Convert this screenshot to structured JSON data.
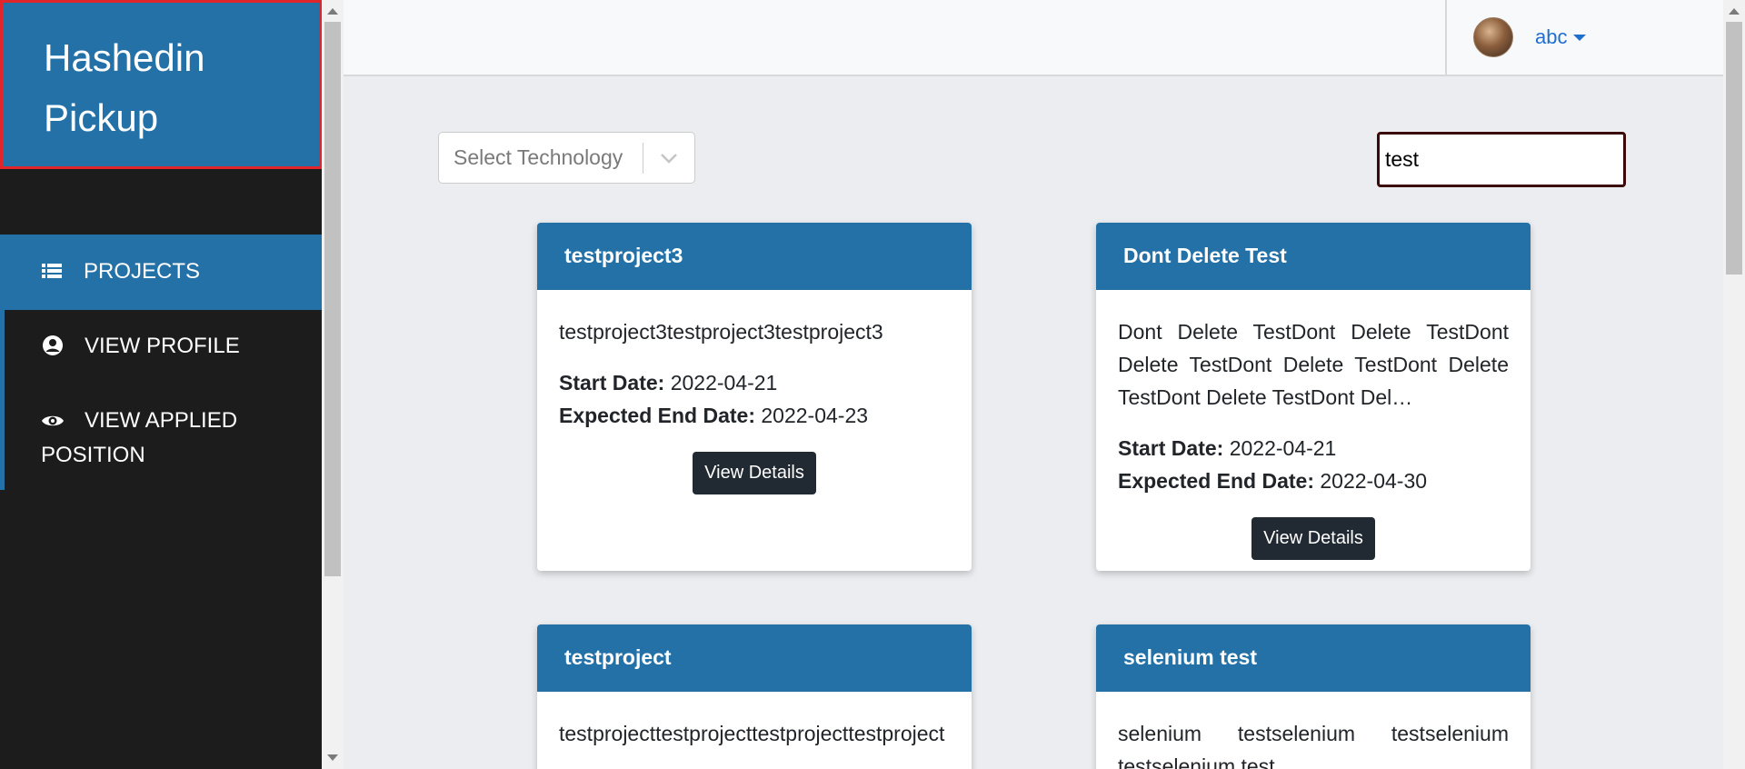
{
  "brand": {
    "line1": "Hashedin",
    "line2": "Pickup"
  },
  "nav": {
    "projects": "PROJECTS",
    "view_profile": "VIEW PROFILE",
    "view_applied_line1": "VIEW APPLIED",
    "view_applied_line2": "POSITION"
  },
  "header": {
    "user_name": "abc"
  },
  "filters": {
    "technology_placeholder": "Select Technology",
    "search_value": "test"
  },
  "labels": {
    "start_date": "Start Date:",
    "end_date": "Expected End Date:",
    "view_details": "View Details"
  },
  "projects": [
    {
      "title": "testproject3",
      "description": "testproject3testproject3testproject3",
      "start_date": "2022-04-21",
      "end_date": "2022-04-23"
    },
    {
      "title": "Dont Delete Test",
      "description": "Dont Delete TestDont Delete TestDont Delete TestDont Delete TestDont Delete TestDont Delete TestDont Del…",
      "start_date": "2022-04-21",
      "end_date": "2022-04-30"
    },
    {
      "title": "testproject",
      "description": "testprojecttestprojecttestprojecttestproject",
      "start_date": "",
      "end_date": ""
    },
    {
      "title": "selenium test",
      "description": "selenium testselenium testselenium testselenium test",
      "start_date": "",
      "end_date": ""
    }
  ],
  "colors": {
    "primary": "#2471a8",
    "sidebar_bg": "#1c1c1c",
    "brand_border": "#e0262a",
    "button_bg": "#212a33",
    "link": "#1f6fd1"
  }
}
